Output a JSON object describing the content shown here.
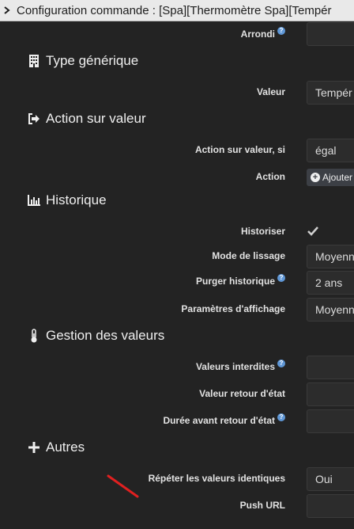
{
  "window": {
    "title": "Configuration commande : [Spa][Thermomètre Spa][Tempér"
  },
  "rows_top": {
    "arrondi_label": "Arrondi"
  },
  "sections": {
    "type_generique": "Type générique",
    "action_sur_valeur": "Action sur valeur",
    "historique": "Historique",
    "gestion_valeurs": "Gestion des valeurs",
    "autres": "Autres"
  },
  "type_generique": {
    "valeur_label": "Valeur",
    "valeur_value": "Tempér"
  },
  "action_sur_valeur": {
    "condition_label": "Action sur valeur, si",
    "condition_value": "égal",
    "action_label": "Action",
    "add_button": "Ajouter"
  },
  "historique": {
    "historiser_label": "Historiser",
    "historiser_checked": true,
    "lissage_label": "Mode de lissage",
    "lissage_value": "Moyenn",
    "purger_label": "Purger historique",
    "purger_value": "2 ans",
    "affichage_label": "Paramètres d'affichage",
    "affichage_value": "Moyenn"
  },
  "gestion_valeurs": {
    "interdites_label": "Valeurs interdites",
    "retour_label": "Valeur retour d'état",
    "duree_label": "Durée avant retour d'état"
  },
  "autres": {
    "repeter_label": "Répéter les valeurs identiques",
    "repeter_value": "Oui",
    "push_label": "Push URL"
  },
  "icons": {
    "titlebar": "chevron-right-icon",
    "type_generique": "building-icon",
    "action_sur_valeur": "sign-out-icon",
    "historique": "bar-chart-icon",
    "gestion_valeurs": "thermometer-icon",
    "autres": "plus-icon",
    "help": "help-circle-icon"
  },
  "colors": {
    "background": "#232323",
    "field": "#2c2c2c",
    "help_badge": "#5f97d6",
    "annotation": "#e02020"
  }
}
